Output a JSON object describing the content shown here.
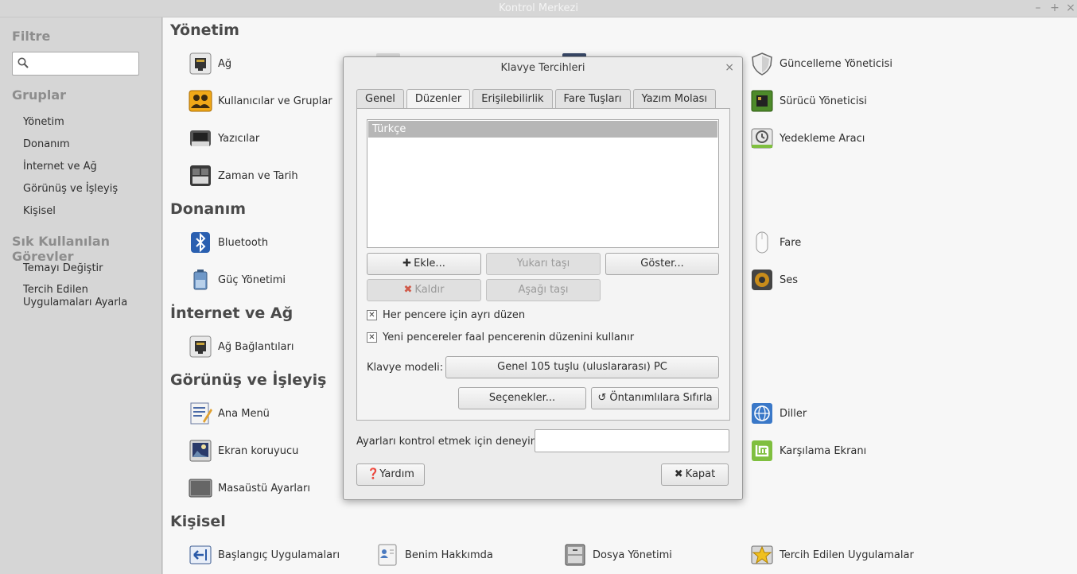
{
  "window": {
    "title": "Kontrol Merkezi",
    "minimize": "–",
    "maximize": "+",
    "close": "×"
  },
  "sidebar": {
    "filter_heading": "Filtre",
    "filter_placeholder": "",
    "groups_heading": "Gruplar",
    "groups": [
      "Yönetim",
      "Donanım",
      "İnternet ve Ağ",
      "Görünüş ve İşleyiş",
      "Kişisel"
    ],
    "common_heading": "Sık Kullanılan Görevler",
    "tasks": [
      "Temayı Değiştir",
      "Tercih Edilen Uygulamaları Ayarla"
    ]
  },
  "sections": {
    "yonetim": {
      "title": "Yönetim",
      "items": [
        "Ağ",
        "Kullanıcılar ve Gruplar",
        "Yazıcılar",
        "Zaman ve Tarih",
        "Güncelleme Yöneticisi",
        "Sürücü Yöneticisi",
        "Yedekleme Aracı"
      ]
    },
    "donanim": {
      "title": "Donanım",
      "items": [
        "Bluetooth",
        "Güç Yönetimi",
        "Fare",
        "Ses"
      ]
    },
    "internet": {
      "title": "İnternet ve Ağ",
      "items": [
        "Ağ Bağlantıları"
      ]
    },
    "gorunus": {
      "title": "Görünüş ve İşleyiş",
      "items": [
        "Ana Menü",
        "Ekran koruyucu",
        "Masaüstü Ayarları",
        "Diller",
        "Karşılama Ekranı"
      ]
    },
    "kisisel": {
      "title": "Kişisel",
      "items": [
        "Başlangıç Uygulamaları",
        "Benim Hakkımda",
        "Dosya Yönetimi",
        "Tercih Edilen Uygulamalar"
      ]
    }
  },
  "dialog": {
    "title": "Klavye Tercihleri",
    "close": "×",
    "tabs": [
      "Genel",
      "Düzenler",
      "Erişilebilirlik",
      "Fare Tuşları",
      "Yazım Molası"
    ],
    "active_tab": "Düzenler",
    "layouts": [
      "Türkçe"
    ],
    "buttons": {
      "add": "Ekle...",
      "move_up": "Yukarı taşı",
      "show": "Göster...",
      "remove": "Kaldır",
      "move_down": "Aşağı taşı",
      "options": "Seçenekler...",
      "reset": "Öntanımlılara Sıfırla",
      "help": "Yardım",
      "close": "Kapat"
    },
    "checkboxes": [
      {
        "label": "Her pencere için ayrı düzen",
        "checked": true
      },
      {
        "label": "Yeni pencereler faal pencerenin düzenini kullanır",
        "checked": true
      }
    ],
    "model_label": "Klavye modeli:",
    "model_value": "Genel 105 tuşlu (uluslararası) PC",
    "test_label": "Ayarları kontrol etmek için deneyin:",
    "test_value": ""
  },
  "icons": {
    "search": "search-icon",
    "plus": "plus-icon",
    "remove": "remove-icon",
    "reset": "reset-icon",
    "help": "help-icon",
    "close": "close-icon"
  },
  "colors": {
    "sidebar_bg": "#d6d6d6",
    "main_bg": "#f7f7f7",
    "dialog_bg": "#ececec",
    "mint_green": "#7fbf3f"
  }
}
